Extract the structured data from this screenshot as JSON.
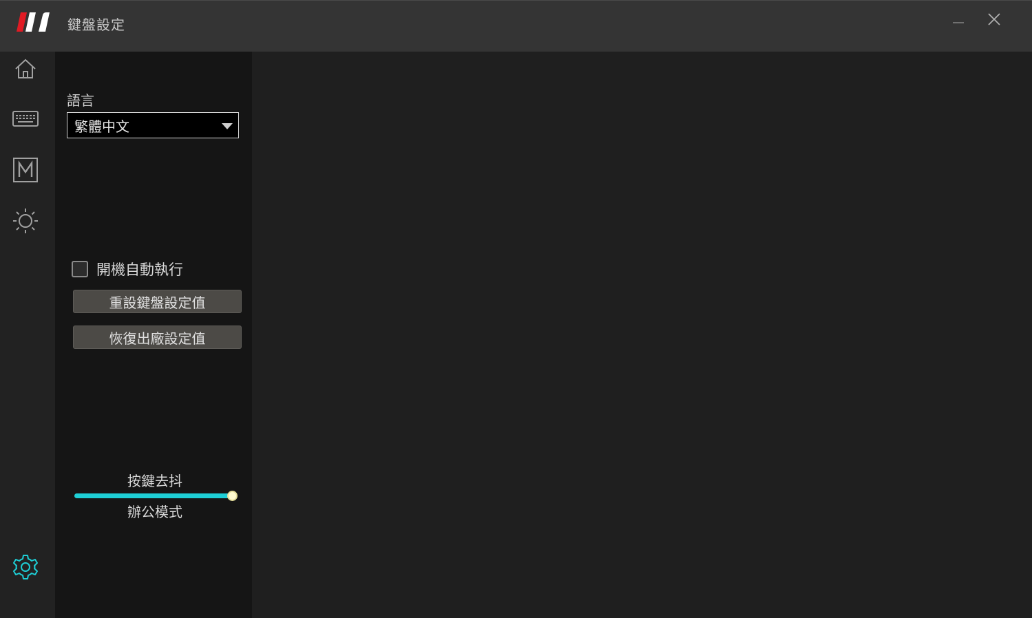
{
  "app": {
    "title": "鍵盤設定",
    "accent_color": "#1ecfd6",
    "brand_color": "#e01b24"
  },
  "window_controls": {
    "minimize_icon": "minimize-icon",
    "close_icon": "close-icon"
  },
  "sidebar": {
    "items": [
      {
        "icon": "home-icon",
        "active": false
      },
      {
        "icon": "keyboard-icon",
        "active": false
      },
      {
        "icon": "macro-m-icon",
        "active": false,
        "glyph": "M"
      },
      {
        "icon": "brightness-sun-icon",
        "active": false
      },
      {
        "icon": "gear-icon",
        "active": true
      }
    ]
  },
  "settings": {
    "language_label": "語言",
    "language_selected": "繁體中文",
    "autostart_label": "開機自動執行",
    "autostart_checked": false,
    "reset_keyboard_label": "重設鍵盤設定值",
    "factory_reset_label": "恢復出廠設定值",
    "debounce_label": "按鍵去抖",
    "debounce_value_fraction": 1.0,
    "debounce_mode_label": "辦公模式"
  }
}
